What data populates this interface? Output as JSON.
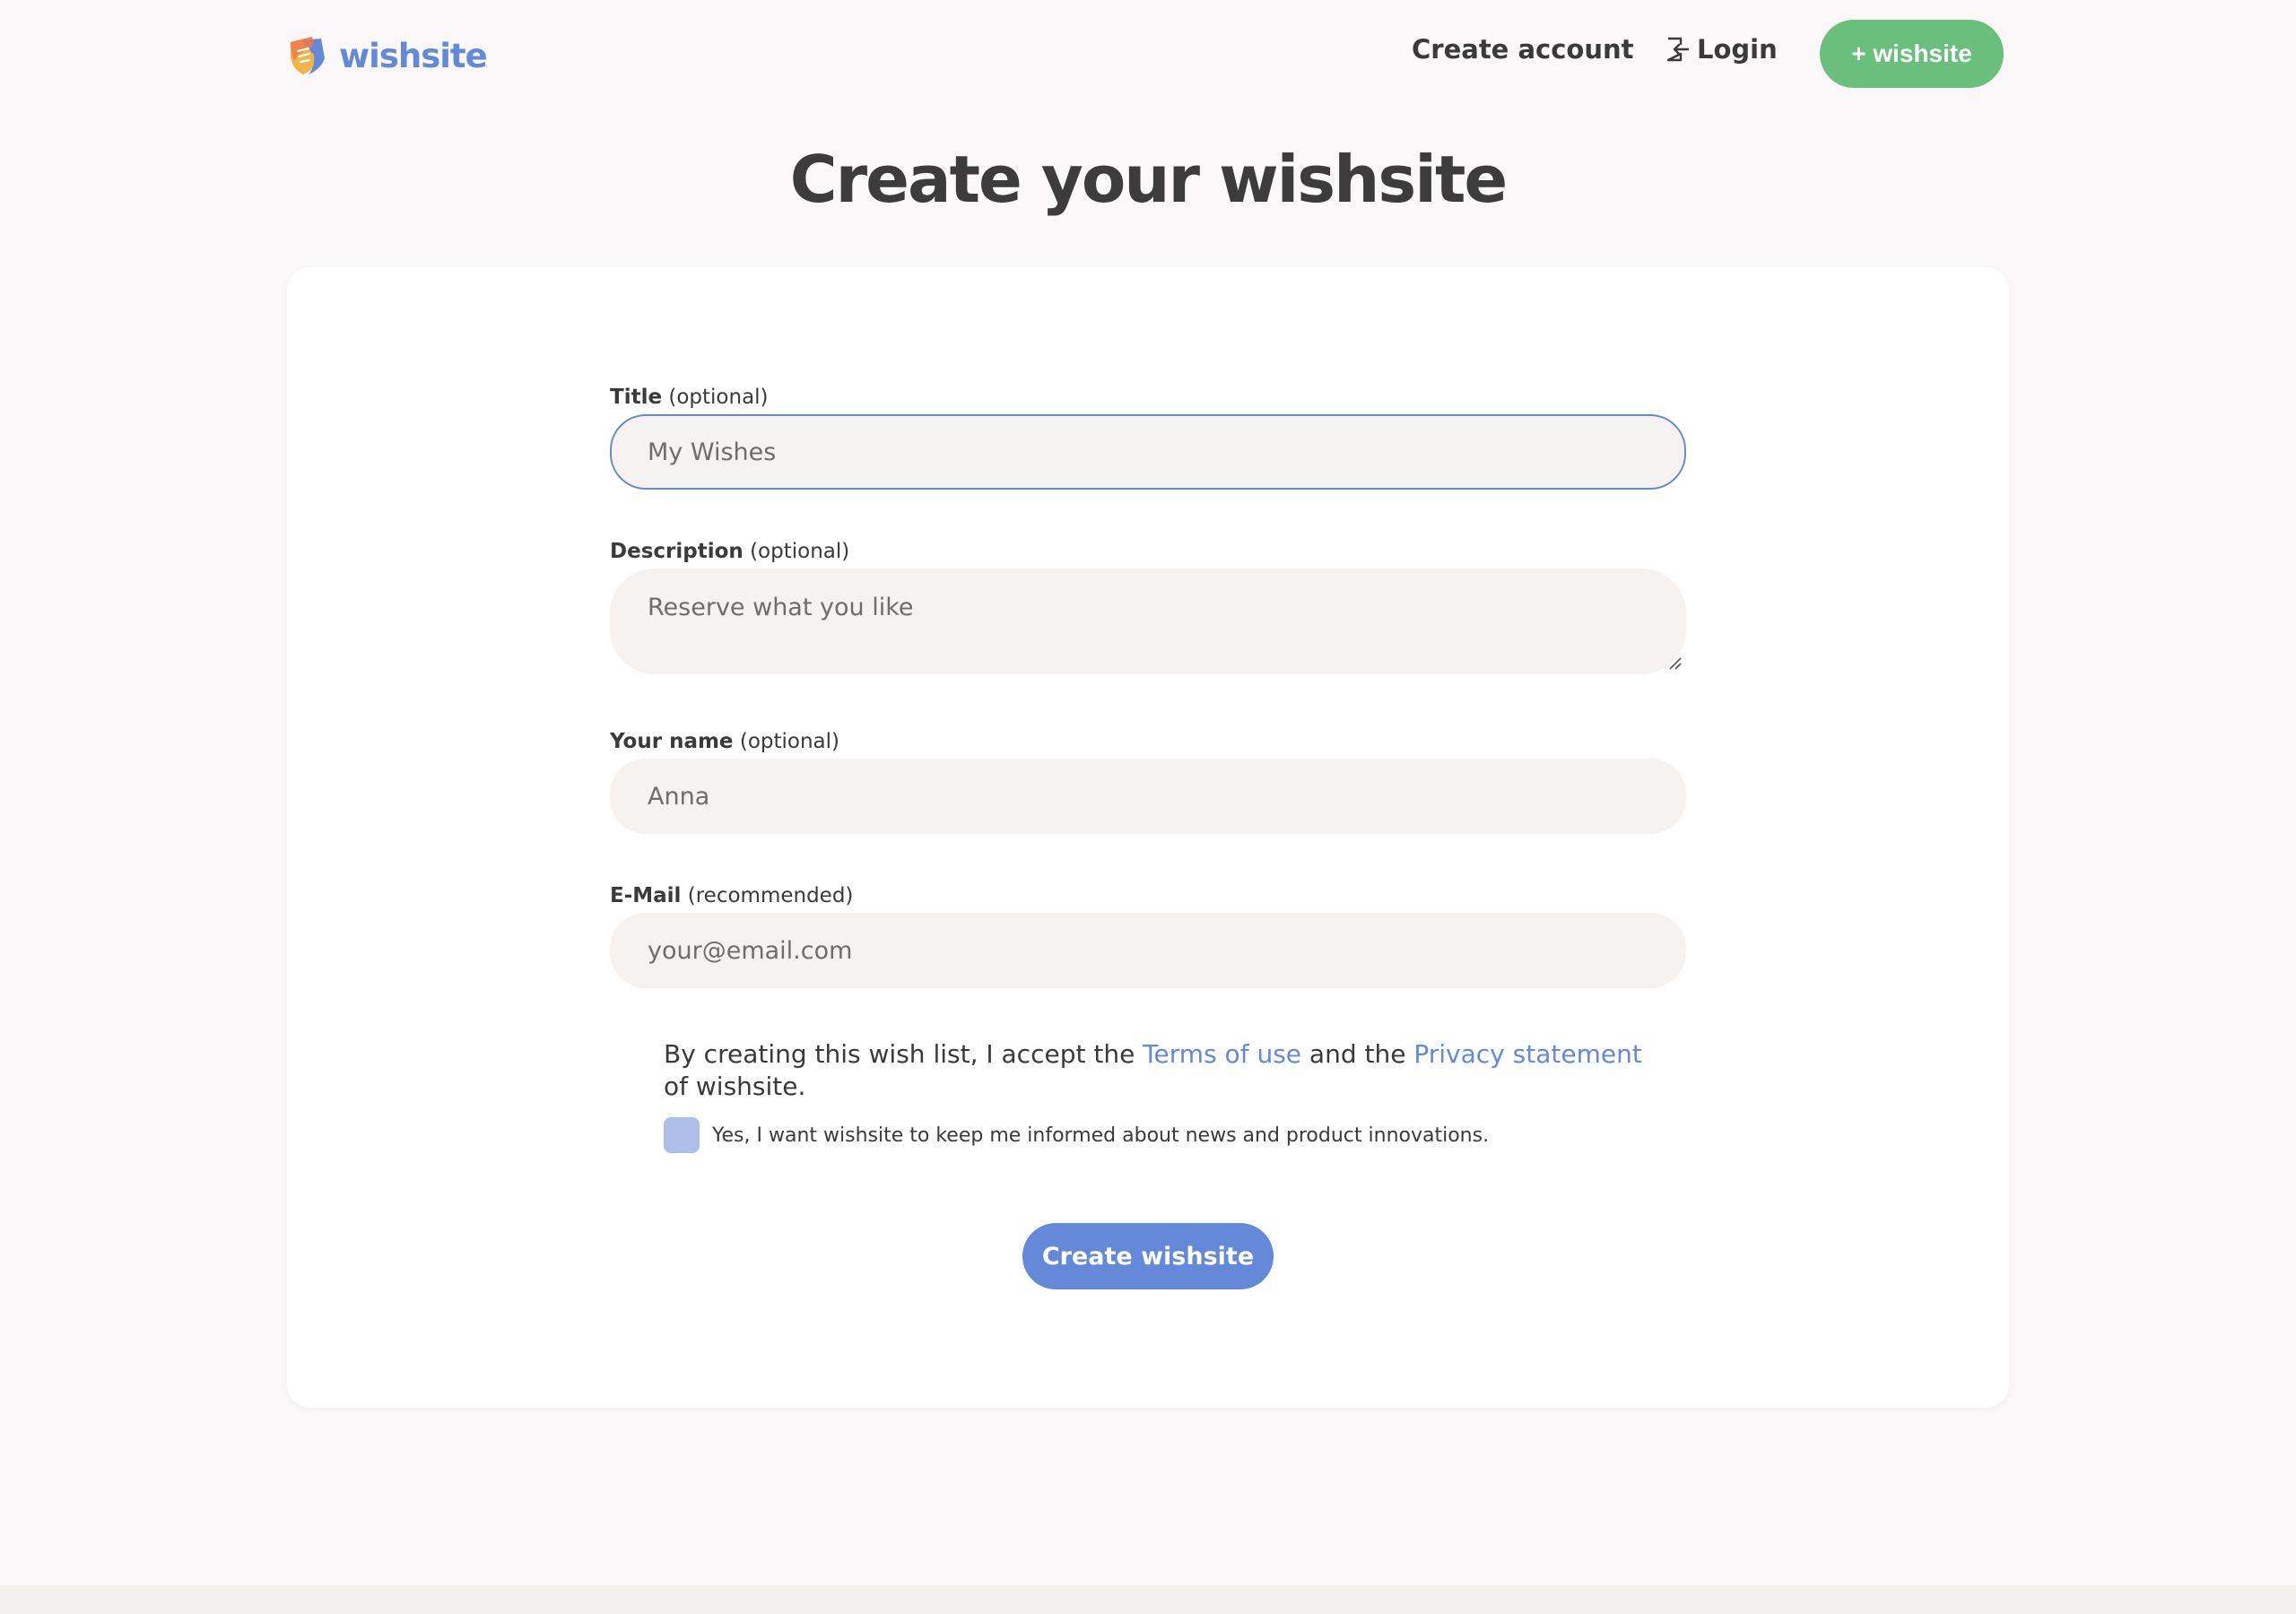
{
  "header": {
    "logo_text": "wishsite",
    "nav": {
      "create_account": "Create account",
      "login": "Login",
      "new_wishsite": "+ wishsite"
    }
  },
  "page": {
    "title": "Create your wishsite"
  },
  "form": {
    "title_field": {
      "label": "Title",
      "hint": "(optional)",
      "placeholder": "My Wishes",
      "value": ""
    },
    "description_field": {
      "label": "Description",
      "hint": "(optional)",
      "placeholder": "Reserve what you like",
      "value": ""
    },
    "name_field": {
      "label": "Your name",
      "hint": "(optional)",
      "placeholder": "Anna",
      "value": ""
    },
    "email_field": {
      "label": "E-Mail",
      "hint": "(recommended)",
      "placeholder": "your@email.com",
      "value": ""
    },
    "consent": {
      "prefix": "By creating this wish list, I accept the ",
      "terms_link": "Terms of use",
      "middle": " and the ",
      "privacy_link": "Privacy statement",
      "suffix": " of wishsite."
    },
    "newsletter": {
      "label": "Yes, I want wishsite to keep me informed about news and product innovations.",
      "checked": false
    },
    "submit_label": "Create wishsite"
  },
  "colors": {
    "brand_blue": "#6489d8",
    "green_button": "#6bbf7c",
    "field_background": "#f5f2ef",
    "page_background": "#faf8f8",
    "checkbox": "#aebfe9"
  },
  "icons": {
    "logo": "wishsite-logo-icon",
    "login": "login-icon"
  }
}
